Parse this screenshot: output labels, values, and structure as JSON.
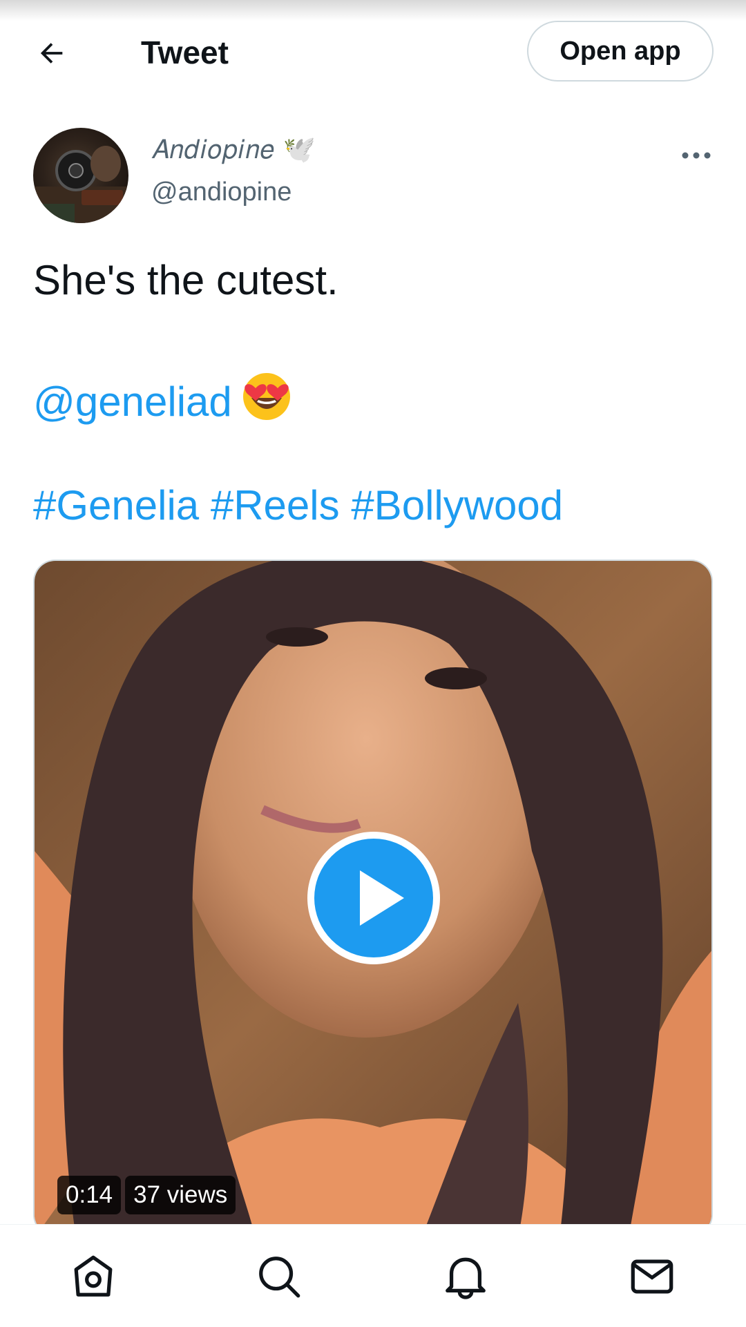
{
  "header": {
    "back_icon": "arrow-left-icon",
    "title": "Tweet",
    "open_app_label": "Open app"
  },
  "author": {
    "display_name": "𝐴𝑛𝑑𝑖𝑜𝑝𝑖𝑛𝑒 🕊️",
    "handle": "@andiopine",
    "more_icon": "more-horizontal-icon"
  },
  "tweet": {
    "line1": "She's the cutest.",
    "mention": "@geneliad",
    "emoji_icon": "heart-eyes-emoji-icon",
    "hashtags": [
      "#Genelia",
      "#Reels",
      "#Bollywood"
    ]
  },
  "media": {
    "duration": "0:14",
    "views": "37 views",
    "play_icon": "play-icon"
  },
  "bottom_nav": {
    "items": [
      "home-icon",
      "search-icon",
      "notifications-icon",
      "messages-icon"
    ]
  },
  "colors": {
    "link": "#1d9bf0",
    "text": "#0f1419",
    "secondary": "#536471",
    "border": "#cfd9de"
  }
}
